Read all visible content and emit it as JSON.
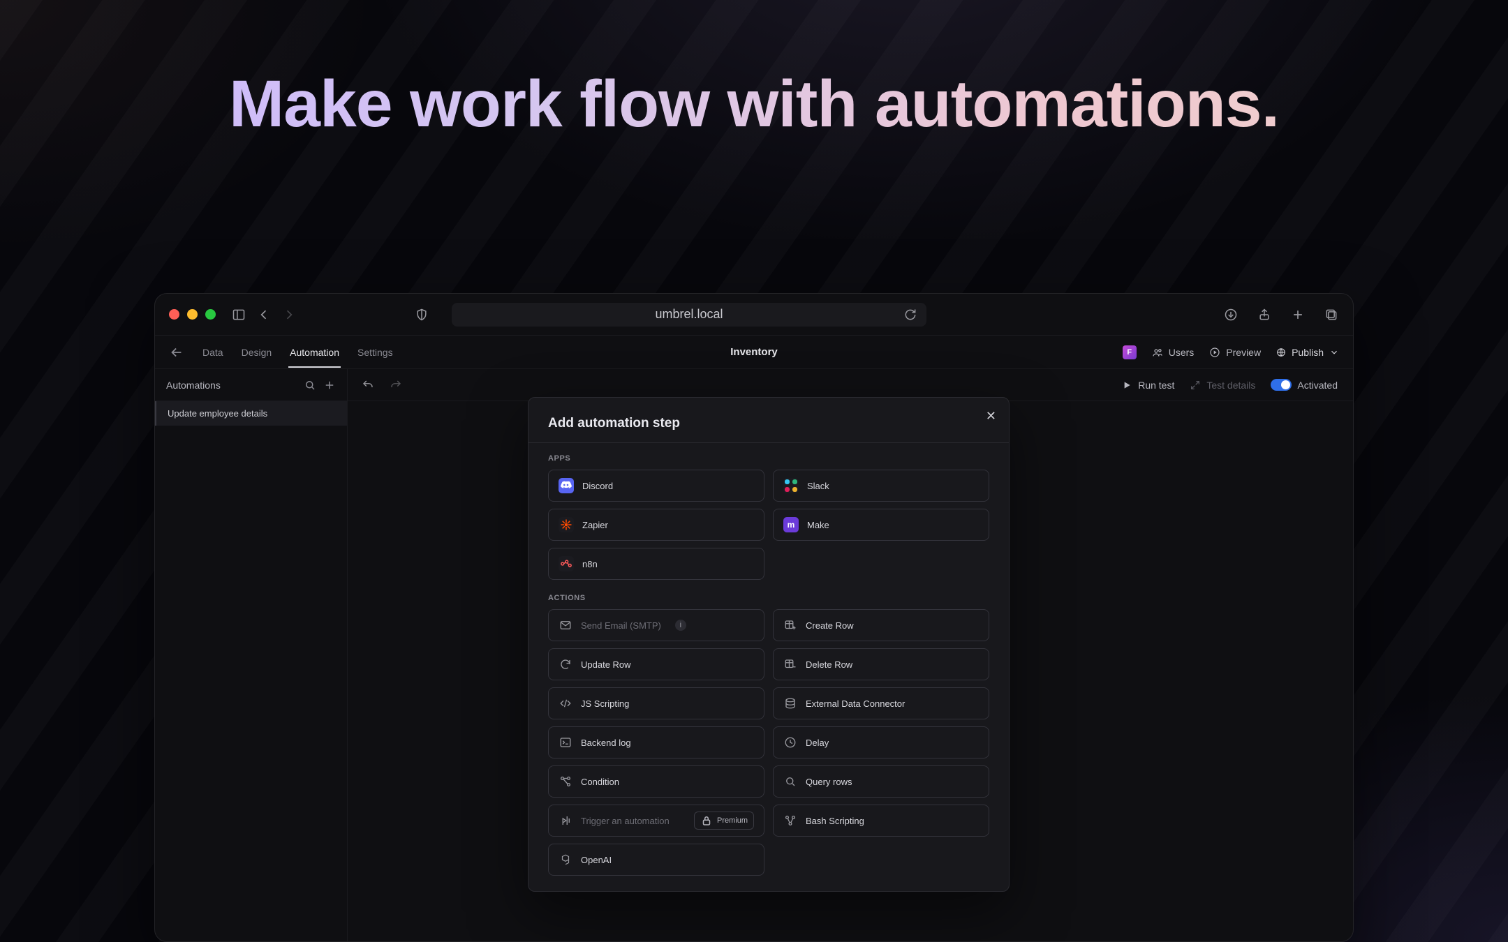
{
  "hero": "Make work flow with automations.",
  "browser": {
    "url": "umbrel.local"
  },
  "app": {
    "title": "Inventory",
    "tabs": [
      "Data",
      "Design",
      "Automation",
      "Settings"
    ],
    "active_tab": "Automation",
    "toolbar": {
      "avatar_initial": "F",
      "users": "Users",
      "preview": "Preview",
      "publish": "Publish"
    },
    "sidebar": {
      "title": "Automations",
      "items": [
        "Update employee details"
      ]
    },
    "runbar": {
      "run_test": "Run test",
      "test_details": "Test details",
      "activated": "Activated"
    }
  },
  "modal": {
    "title": "Add automation step",
    "sections": {
      "apps": {
        "label": "APPS",
        "items": [
          {
            "id": "discord",
            "label": "Discord"
          },
          {
            "id": "slack",
            "label": "Slack"
          },
          {
            "id": "zapier",
            "label": "Zapier"
          },
          {
            "id": "make",
            "label": "Make"
          },
          {
            "id": "n8n",
            "label": "n8n"
          }
        ]
      },
      "actions": {
        "label": "ACTIONS",
        "items": [
          {
            "id": "send-email",
            "label": "Send Email (SMTP)",
            "disabled": true,
            "info": true
          },
          {
            "id": "create-row",
            "label": "Create Row"
          },
          {
            "id": "update-row",
            "label": "Update Row"
          },
          {
            "id": "delete-row",
            "label": "Delete Row"
          },
          {
            "id": "js-scripting",
            "label": "JS Scripting"
          },
          {
            "id": "external-data",
            "label": "External Data Connector"
          },
          {
            "id": "backend-log",
            "label": "Backend log"
          },
          {
            "id": "delay",
            "label": "Delay"
          },
          {
            "id": "condition",
            "label": "Condition"
          },
          {
            "id": "query-rows",
            "label": "Query rows"
          },
          {
            "id": "trigger-automation",
            "label": "Trigger an automation",
            "disabled": true,
            "premium": "Premium"
          },
          {
            "id": "bash",
            "label": "Bash Scripting"
          },
          {
            "id": "openai",
            "label": "OpenAI"
          }
        ]
      }
    }
  }
}
